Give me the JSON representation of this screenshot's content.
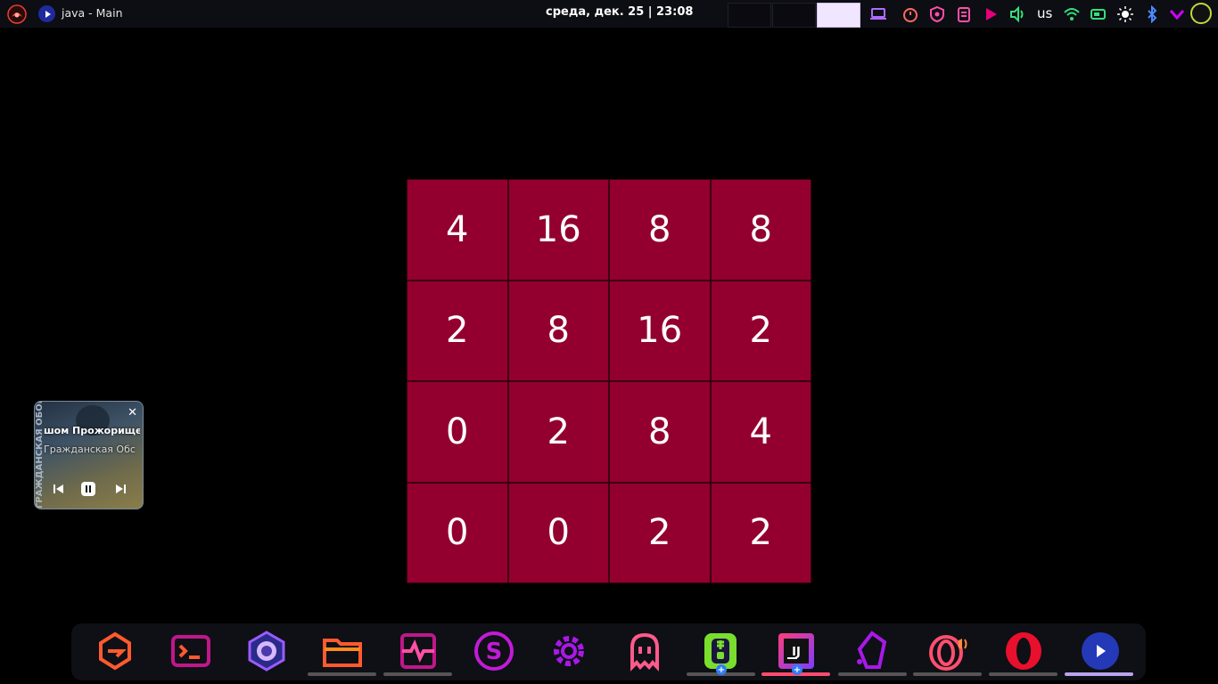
{
  "topbar": {
    "window_title": "java - Main",
    "clock": "среда, дек. 25 | 23:08",
    "keyboard_layout": "us",
    "workspaces": [
      {
        "active": false
      },
      {
        "active": false
      },
      {
        "active": true
      }
    ],
    "tray_icons": [
      "laptop-icon",
      "timer-icon",
      "shield-icon",
      "notes-icon",
      "media-play-icon",
      "volume-icon",
      "keyboard-layout",
      "wifi-icon",
      "battery-icon",
      "brightness-icon",
      "bluetooth-icon",
      "chevron-down-icon"
    ]
  },
  "game": {
    "board": [
      [
        "4",
        "16",
        "8",
        "8"
      ],
      [
        "2",
        "8",
        "16",
        "2"
      ],
      [
        "0",
        "2",
        "8",
        "4"
      ],
      [
        "0",
        "0",
        "2",
        "2"
      ]
    ],
    "tile_color": "#93002f"
  },
  "media": {
    "title": "шом Прожорище",
    "artist": "Гражданская Обс",
    "cover_text": "ГРАЖДАНСКАЯ ОБОРОНА"
  },
  "dock": {
    "apps": [
      {
        "name": "app-launcher-icon",
        "indicator": "none"
      },
      {
        "name": "terminal-icon",
        "indicator": "none"
      },
      {
        "name": "browser-icon",
        "indicator": "none"
      },
      {
        "name": "files-icon",
        "indicator": "gray"
      },
      {
        "name": "system-monitor-icon",
        "indicator": "gray"
      },
      {
        "name": "stacer-icon",
        "indicator": "none"
      },
      {
        "name": "settings-icon",
        "indicator": "none"
      },
      {
        "name": "ghost-icon",
        "indicator": "none"
      },
      {
        "name": "zipper-icon",
        "indicator": "gray"
      },
      {
        "name": "intellij-icon",
        "indicator": "red"
      },
      {
        "name": "crystal-icon",
        "indicator": "gray"
      },
      {
        "name": "opera-gx-icon",
        "indicator": "gray"
      },
      {
        "name": "opera-icon",
        "indicator": "gray"
      },
      {
        "name": "java-app-icon",
        "indicator": "purple"
      }
    ],
    "accent": "#d000ff"
  }
}
